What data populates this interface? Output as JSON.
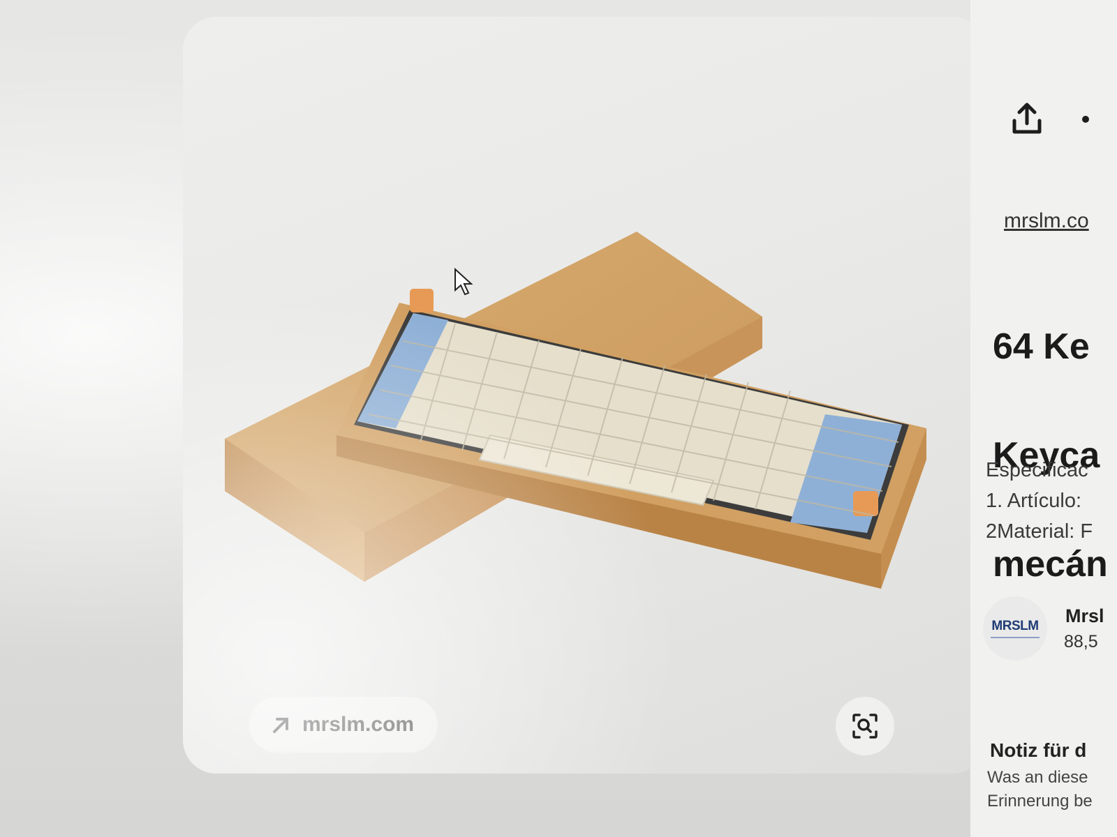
{
  "pin": {
    "source_label": "mrslm.com"
  },
  "detail": {
    "site_link": "mrslm.co",
    "title_lines": [
      "64 Ke",
      "Keyca",
      "mecán"
    ],
    "description_lines": [
      "Especificac",
      "1. Artículo:",
      "2Material: F"
    ],
    "account": {
      "logo_text": "MRSLM",
      "name": "Mrsl",
      "followers": "88,5"
    },
    "note": {
      "title": "Notiz für d",
      "text_lines": [
        "Was an diese",
        "Erinnerung be"
      ]
    }
  },
  "icons": {
    "share": "share-icon",
    "more": "more-icon",
    "source_arrow": "arrow-up-right-icon",
    "visual_search": "visual-search-icon",
    "cursor": "cursor-icon"
  },
  "colors": {
    "wood": "#d7aa6c",
    "keycap_blue": "#8fb0d6",
    "keycap_cream": "#ece6d4",
    "keycap_orange": "#e79a55",
    "logo_blue": "#1f3c74"
  }
}
